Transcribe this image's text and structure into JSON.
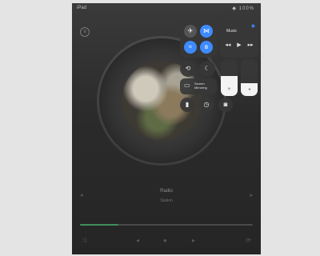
{
  "status_bar": {
    "left_text": "iPad",
    "right_text": "◆ 100%"
  },
  "player": {
    "menu_icon": "menu-icon",
    "progress": 0.22,
    "track_title": "Radio",
    "track_subtitle": "Station"
  },
  "control_center": {
    "connectivity": [
      {
        "name": "airplane-mode",
        "glyph": "✈",
        "active": false
      },
      {
        "name": "cellular",
        "glyph": "⋈",
        "active": true
      },
      {
        "name": "wifi",
        "glyph": "≈",
        "active": true
      },
      {
        "name": "bluetooth",
        "glyph": "ʙ",
        "active": true
      }
    ],
    "music": {
      "title": "Music",
      "prev_glyph": "◂◂",
      "play_glyph": "▶",
      "next_glyph": "▸▸",
      "airplay_glyph": "◉"
    },
    "rotation_lock_glyph": "⟲",
    "do_not_disturb_glyph": "☾",
    "screen_mirroring": {
      "glyph": "▭",
      "label_line1": "Screen",
      "label_line2": "Mirroring"
    },
    "brightness": {
      "level": 0.55,
      "glyph": "☀"
    },
    "volume": {
      "level": 0.35,
      "glyph": "◂"
    },
    "bottom_row": [
      {
        "name": "flashlight",
        "glyph": "▮"
      },
      {
        "name": "timer",
        "glyph": "◷"
      },
      {
        "name": "camera",
        "glyph": "◙"
      }
    ]
  },
  "colors": {
    "accent_blue": "#3d8bff",
    "tile_bg": "#373737",
    "progress_green": "#3e8f5a"
  }
}
